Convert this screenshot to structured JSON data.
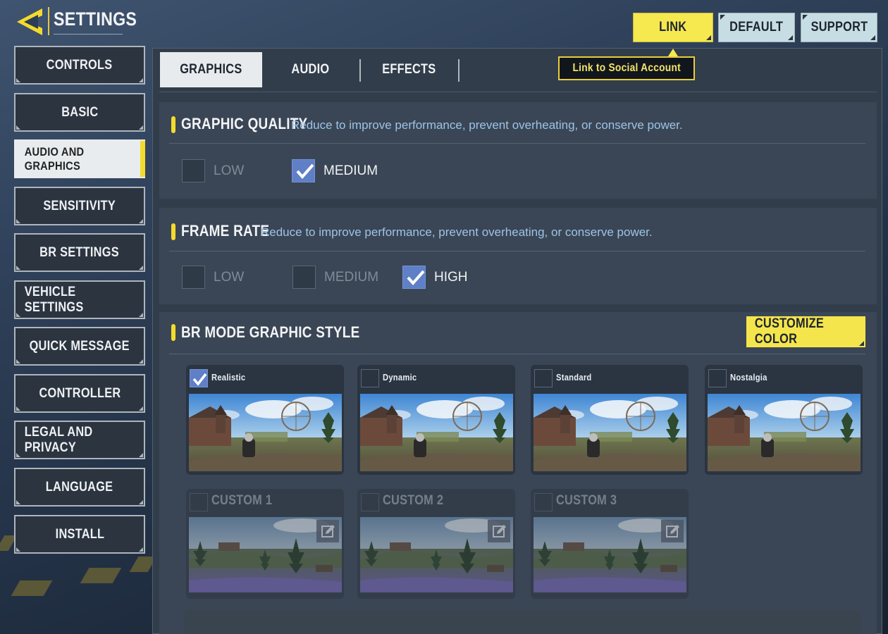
{
  "header": {
    "title": "SETTINGS",
    "back_icon": "back-arrow-icon"
  },
  "top_buttons": {
    "link": "LINK",
    "default": "DEFAULT",
    "support": "SUPPORT",
    "tooltip": "Link to Social Account"
  },
  "sidebar": {
    "items": [
      {
        "label": "CONTROLS",
        "active": false
      },
      {
        "label": "BASIC",
        "active": false
      },
      {
        "label": "AUDIO AND GRAPHICS",
        "active": true
      },
      {
        "label": "SENSITIVITY",
        "active": false
      },
      {
        "label": "BR SETTINGS",
        "active": false
      },
      {
        "label": "VEHICLE SETTINGS",
        "active": false
      },
      {
        "label": "QUICK MESSAGE",
        "active": false
      },
      {
        "label": "CONTROLLER",
        "active": false
      },
      {
        "label": "LEGAL AND PRIVACY",
        "active": false
      },
      {
        "label": "LANGUAGE",
        "active": false
      },
      {
        "label": "INSTALL",
        "active": false
      }
    ]
  },
  "tabs": [
    {
      "label": "GRAPHICS",
      "active": true
    },
    {
      "label": "AUDIO",
      "active": false
    },
    {
      "label": "EFFECTS",
      "active": false
    }
  ],
  "graphic_quality": {
    "title": "GRAPHIC QUALITY",
    "description": "Reduce to improve performance, prevent overheating, or conserve power.",
    "options": [
      {
        "label": "LOW",
        "checked": false
      },
      {
        "label": "MEDIUM",
        "checked": true
      }
    ]
  },
  "frame_rate": {
    "title": "FRAME RATE",
    "description": "Reduce to improve performance, prevent overheating, or conserve power.",
    "options": [
      {
        "label": "LOW",
        "checked": false
      },
      {
        "label": "MEDIUM",
        "checked": false
      },
      {
        "label": "HIGH",
        "checked": true
      }
    ]
  },
  "br_mode": {
    "title": "BR MODE GRAPHIC STYLE",
    "customize_label": "CUSTOMIZE COLOR",
    "styles": [
      {
        "label": "Realistic",
        "checked": true
      },
      {
        "label": "Dynamic",
        "checked": false
      },
      {
        "label": "Standard",
        "checked": false
      },
      {
        "label": "Nostalgia",
        "checked": false
      }
    ],
    "custom_styles": [
      {
        "label": "CUSTOM 1",
        "checked": false
      },
      {
        "label": "CUSTOM 2",
        "checked": false
      },
      {
        "label": "CUSTOM 3",
        "checked": false
      }
    ]
  },
  "colors": {
    "accent_yellow": "#f3db2d",
    "checkbox_blue": "#5f7fc7",
    "description_blue": "#9dc3e6"
  }
}
